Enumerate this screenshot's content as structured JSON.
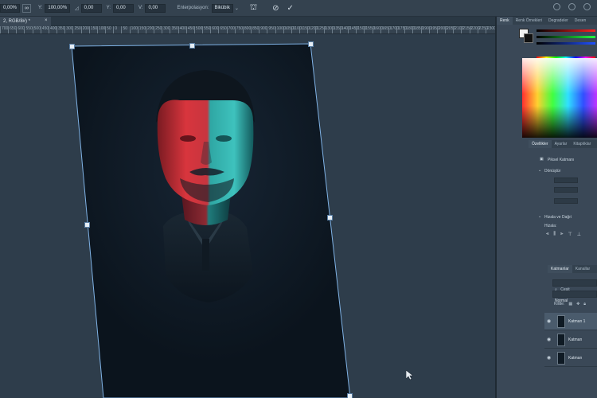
{
  "options_bar": {
    "x_value": "0,00%",
    "y_label": "Y:",
    "y_value": "100,00%",
    "angle_value": "0,00",
    "h_label": "Y:",
    "h_value": "0,00",
    "v_label": "V:",
    "v_value": "0,00",
    "interp_label": "Enterpolasyon:",
    "interp_value": "Bikübik"
  },
  "document_tab": {
    "label": "2, RGB/8#) *"
  },
  "ruler": {
    "ticks": [
      "700",
      "650",
      "600",
      "550",
      "500",
      "450",
      "400",
      "350",
      "300",
      "250",
      "200",
      "150",
      "100",
      "50",
      "0",
      "50",
      "100",
      "150",
      "200",
      "250",
      "300",
      "350",
      "400",
      "450",
      "500",
      "550",
      "600",
      "650",
      "700",
      "750",
      "800",
      "850",
      "900",
      "950",
      "1000",
      "1050",
      "1100",
      "1150",
      "1200",
      "1250",
      "1300",
      "1350",
      "1400",
      "1450",
      "1500",
      "1550",
      "1600",
      "1650",
      "1700",
      "1750",
      "1800",
      "1850",
      "1900",
      "1950",
      "2000",
      "2050",
      "2100",
      "2150",
      "2200",
      "2250",
      "2300"
    ]
  },
  "panel": {
    "top_tabs": [
      "Renk",
      "Renk Örnekleri",
      "Degradeler",
      "Desen"
    ],
    "mid_tabs": [
      "Özellikler",
      "Ayarlar",
      "Kitaplıklar"
    ],
    "pixel_layer_label": "Piksel Katmanı",
    "transform_label": "Dönüştür",
    "align_label": "Hizala ve Dağıt",
    "align_sub": "Hizala:",
    "layer_tabs": [
      "Katmanlar",
      "Kanallar"
    ],
    "search_label": "Çeşit",
    "blend_mode": "Normal",
    "lock_label": "Kilitle:",
    "layers": [
      "Katman 1",
      "Katman",
      "Katman"
    ]
  },
  "colors": {
    "canvas_bg": "#2e3d4b",
    "doc_bg": "#0c1620",
    "selection": "#7fb2e5",
    "face_red": "#d6343c",
    "face_cyan": "#37b7b3"
  }
}
